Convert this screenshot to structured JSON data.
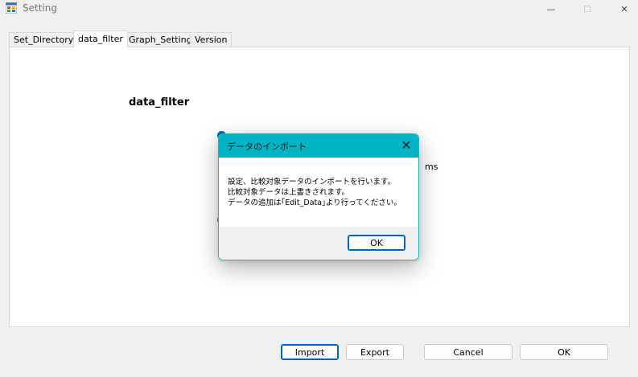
{
  "window": {
    "title": "Setting",
    "icon": "app-form-icon",
    "controls": {
      "minimize": "—",
      "maximize": "☐",
      "close": "✕"
    }
  },
  "tabs": [
    {
      "label": "Set_Directory",
      "active": false
    },
    {
      "label": "data_filter",
      "active": true
    },
    {
      "label": "Graph_Setting",
      "active": false
    },
    {
      "label": "Version",
      "active": false
    }
  ],
  "panel": {
    "section_title": "data_filter",
    "unit_label": "ms"
  },
  "buttons": {
    "import": "Import",
    "export": "Export",
    "cancel": "Cancel",
    "ok": "OK"
  },
  "dialog": {
    "title": "データのインポート",
    "close_glyph": "✕",
    "message_lines": [
      "設定、比較対象データのインポートを行います。",
      "比較対象データは上書きされます。",
      "データの追加は｢Edit_Data｣より行ってください。"
    ],
    "ok": "OK",
    "accent_color": "#00b4c4"
  }
}
